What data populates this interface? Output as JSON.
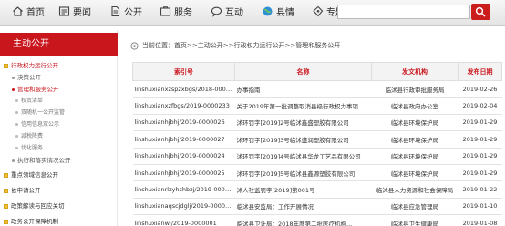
{
  "nav": {
    "items": [
      {
        "label": "首页",
        "icon": "home-icon"
      },
      {
        "label": "要闻",
        "icon": "newspaper-icon"
      },
      {
        "label": "公开",
        "icon": "document-icon"
      },
      {
        "label": "服务",
        "icon": "service-icon"
      },
      {
        "label": "互动",
        "icon": "chat-icon"
      },
      {
        "label": "县情",
        "icon": "globe-icon"
      },
      {
        "label": "专题",
        "icon": "special-icon"
      }
    ],
    "search_placeholder": ""
  },
  "sidebar": {
    "title": "主动公开",
    "items": [
      {
        "label": "行政权力运行公开",
        "level": 1
      },
      {
        "label": "决策公开",
        "level": 2
      },
      {
        "label": "管理和服务公开",
        "level": 2
      },
      {
        "label": "权责清单",
        "level": 3
      },
      {
        "label": "双随机一公开监管",
        "level": 3
      },
      {
        "label": "信用信息双公示",
        "level": 3
      },
      {
        "label": "减税降费",
        "level": 3
      },
      {
        "label": "优化服务",
        "level": 3
      },
      {
        "label": "执行和落实情况公开",
        "level": 2
      },
      {
        "label": "重点领域信息公开",
        "level": 1
      },
      {
        "label": "依申请公开",
        "level": 1
      },
      {
        "label": "政策解读与回应关切",
        "level": 1
      },
      {
        "label": "政务公开保障机制",
        "level": 1
      }
    ]
  },
  "breadcrumb": {
    "text": "当前位置：首页>>主动公开>>行政权力运行公开>>管理和服务公开"
  },
  "table": {
    "headers": [
      "索引号",
      "名称",
      "发文机构",
      "发布日期"
    ],
    "rows": [
      [
        "linshuxianxzspzxbgs/2018-0000186",
        "办事指南",
        "临沭县行政审批服务局",
        "2019-02-26"
      ],
      [
        "linshuxianxzfbgs/2019-0000233",
        "关于2019年第一批调整取消县级行政权力事项...",
        "临沭县政府办公室",
        "2019-02-04"
      ],
      [
        "linshuxianhjbhj/2019-0000026",
        "沭环罚字[2019]2号临沭鑫盛塑胶有限公司",
        "临沭县环境保护局",
        "2019-01-29"
      ],
      [
        "linshuxianhjbhj/2019-0000027",
        "沭环罚字[2019]3号临沭盛润塑胶有限公司",
        "临沭县环境保护局",
        "2019-01-29"
      ],
      [
        "linshuxianhjbhj/2019-0000024",
        "沭环罚字[2019]4号临沭县华龙工艺品有限公司",
        "临沭县环境保护局",
        "2019-01-29"
      ],
      [
        "linshuxianhjbhj/2019-0000025",
        "沭环罚字[2019]5号临沭县鑫源塑胶有限公司",
        "临沭县环境保护局",
        "2019-01-29"
      ],
      [
        "linshuxianrlzyhshbzj/2019-0000078",
        "沭人社监罚字[2019]第001号",
        "临沭县人力资源和社会保障局",
        "2019-01-22"
      ],
      [
        "linshuxianaqscjdglj/2019-0000001",
        "临沭县安监局：工作开展情况",
        "临沭县应急管理局",
        "2019-01-10"
      ],
      [
        "linshuxianwj/2019-0000001",
        "临沭县卫计局：2018年度第二批医疗机构...",
        "临沭县卫生健康局",
        "2019-01-08"
      ]
    ]
  },
  "colors": {
    "accent": "#c9161d",
    "nav_bg": "#eeeeee",
    "folder": "#f1c232"
  }
}
